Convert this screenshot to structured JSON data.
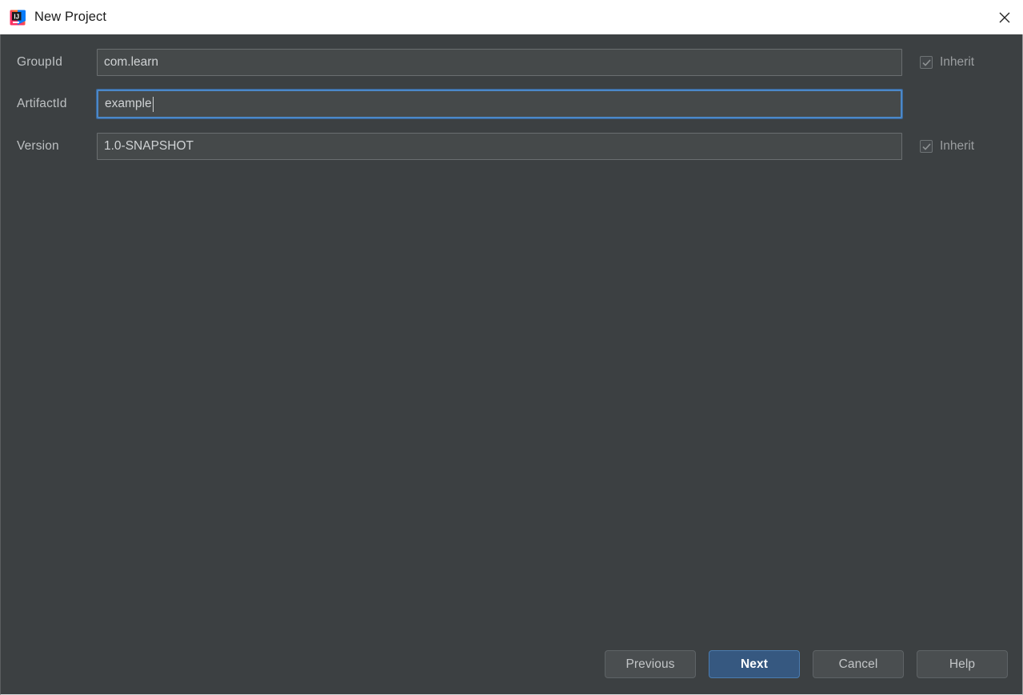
{
  "window": {
    "title": "New Project",
    "app_icon": "intellij-idea-icon",
    "close_icon": "close-icon"
  },
  "form": {
    "rows": [
      {
        "label": "GroupId",
        "value": "com.learn",
        "placeholder": "",
        "focused": false,
        "has_inherit": true,
        "inherit_label": "Inherit",
        "inherit_checked": true
      },
      {
        "label": "ArtifactId",
        "value": "example",
        "placeholder": "",
        "focused": true,
        "has_inherit": false,
        "inherit_label": "",
        "inherit_checked": false
      },
      {
        "label": "Version",
        "value": "1.0-SNAPSHOT",
        "placeholder": "",
        "focused": false,
        "has_inherit": true,
        "inherit_label": "Inherit",
        "inherit_checked": true
      }
    ]
  },
  "footer": {
    "buttons": [
      {
        "label": "Previous",
        "default": false
      },
      {
        "label": "Next",
        "default": true
      },
      {
        "label": "Cancel",
        "default": false
      },
      {
        "label": "Help",
        "default": false
      }
    ]
  },
  "colors": {
    "titlebar_bg": "#ffffff",
    "dialog_bg": "#3c4042",
    "field_bg": "#45494a",
    "field_border": "#6a6e70",
    "focus_border": "#4b88c9",
    "accent_button": "#365880",
    "label_text": "#bdc0c2",
    "value_text": "#cfd2d4"
  }
}
